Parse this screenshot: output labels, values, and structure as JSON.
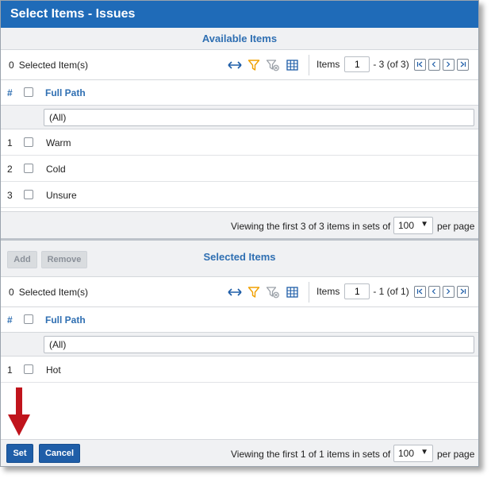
{
  "dialog": {
    "title": "Select Items - Issues"
  },
  "available": {
    "header": "Available Items",
    "selected_count": "0",
    "selected_label": "Selected Item(s)",
    "pager": {
      "label": "Items",
      "page": "1",
      "range": "- 3 (of 3)"
    },
    "columns": {
      "hash": "#",
      "full_path": "Full Path"
    },
    "filter_value": "(All)",
    "rows": [
      {
        "index": "1",
        "value": "Warm"
      },
      {
        "index": "2",
        "value": "Cold"
      },
      {
        "index": "3",
        "value": "Unsure"
      }
    ],
    "footer": {
      "viewing": "Viewing the first 3 of 3 items in sets of",
      "page_size": "100",
      "per_page": "per page"
    }
  },
  "actions": {
    "add_label": "Add",
    "remove_label": "Remove"
  },
  "selected": {
    "header": "Selected Items",
    "selected_count": "0",
    "selected_label": "Selected Item(s)",
    "pager": {
      "label": "Items",
      "page": "1",
      "range": "- 1 (of 1)"
    },
    "columns": {
      "hash": "#",
      "full_path": "Full Path"
    },
    "filter_value": "(All)",
    "rows": [
      {
        "index": "1",
        "value": "Hot"
      }
    ],
    "footer": {
      "viewing": "Viewing the first 1 of 1 items in sets of",
      "page_size": "100",
      "per_page": "per page"
    }
  },
  "buttons": {
    "set_label": "Set",
    "cancel_label": "Cancel"
  },
  "icons": {
    "expand": "horizontal-resize-icon",
    "filter": "filter-icon",
    "clear_filter": "clear-filter-icon",
    "columns": "column-chooser-icon",
    "first": "first-page-icon",
    "prev": "previous-page-icon",
    "next": "next-page-icon",
    "last": "last-page-icon"
  },
  "colors": {
    "title_bar": "#1f6bb8",
    "accent_text": "#2f6fb2",
    "primary_button": "#1f5ea8",
    "annotation_arrow": "#c0141c",
    "filter_icon": "#f0a000"
  }
}
